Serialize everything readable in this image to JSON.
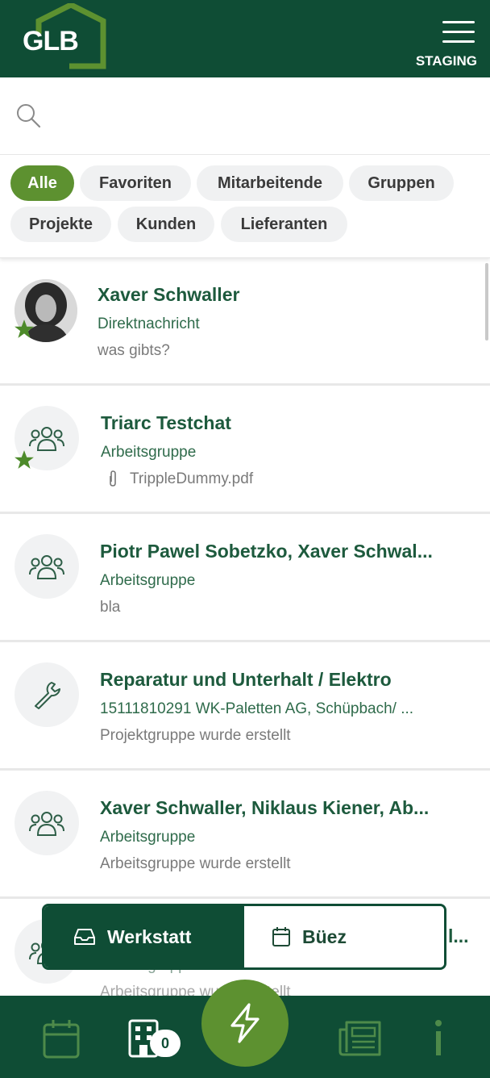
{
  "header": {
    "logo_text": "GLB",
    "environment": "STAGING"
  },
  "search": {
    "placeholder": "",
    "value": ""
  },
  "filters": [
    {
      "label": "Alle",
      "active": true
    },
    {
      "label": "Favoriten",
      "active": false
    },
    {
      "label": "Mitarbeitende",
      "active": false
    },
    {
      "label": "Gruppen",
      "active": false
    },
    {
      "label": "Projekte",
      "active": false
    },
    {
      "label": "Kunden",
      "active": false
    },
    {
      "label": "Lieferanten",
      "active": false
    }
  ],
  "chats": [
    {
      "title": "Xaver Schwaller",
      "subtitle": "Direktnachricht",
      "message": "was gibts?",
      "favorite": true,
      "icon": "person-photo"
    },
    {
      "title": "Triarc Testchat",
      "subtitle": "Arbeitsgruppe",
      "message": "TrippleDummy.pdf",
      "favorite": true,
      "icon": "group-icon",
      "attachment_icon": "paperclip-icon"
    },
    {
      "title": "Piotr Pawel Sobetzko, Xaver Schwal...",
      "subtitle": "Arbeitsgruppe",
      "message": "bla",
      "favorite": false,
      "icon": "group-icon"
    },
    {
      "title": "Reparatur und Unterhalt / Elektro",
      "subtitle": "15111810291 WK-Paletten AG, Schüpbach/ ...",
      "message": "Projektgruppe wurde erstellt",
      "favorite": false,
      "icon": "wrench-icon"
    },
    {
      "title": "Xaver Schwaller, Niklaus Kiener, Ab...",
      "subtitle": "Arbeitsgruppe",
      "message": "Arbeitsgruppe wurde erstellt",
      "favorite": false,
      "icon": "group-icon"
    },
    {
      "title": "l...",
      "subtitle": "Arbeitsgruppe",
      "message": "Arbeitsgruppe wurde erstellt",
      "favorite": false,
      "icon": "group-icon"
    }
  ],
  "mode_toggle": {
    "options": [
      {
        "label": "Werkstatt",
        "icon": "inbox-icon",
        "active": true
      },
      {
        "label": "Büez",
        "icon": "calendar-icon",
        "active": false
      }
    ]
  },
  "bottom_nav": {
    "items": [
      {
        "name": "calendar",
        "icon": "calendar-icon"
      },
      {
        "name": "buildings",
        "icon": "building-icon",
        "badge": "0"
      },
      {
        "name": "actions",
        "icon": "lightning-icon"
      },
      {
        "name": "news",
        "icon": "newspaper-icon"
      },
      {
        "name": "info",
        "icon": "info-icon"
      }
    ]
  },
  "colors": {
    "primary_dark": "#0f4d35",
    "accent_green": "#5d9130",
    "chip_bg": "#f0f1f2"
  }
}
